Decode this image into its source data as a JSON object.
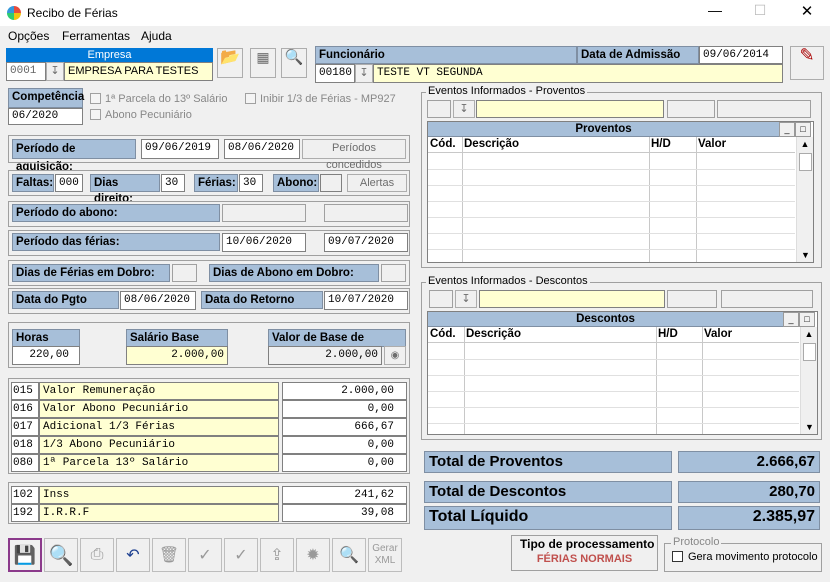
{
  "window": {
    "title": "Recibo de Férias"
  },
  "menu": [
    "Opções",
    "Ferramentas",
    "Ajuda"
  ],
  "empresa": {
    "label": "Empresa",
    "code": "0001",
    "name": "EMPRESA PARA TESTES"
  },
  "funcionario": {
    "label": "Funcionário",
    "code": "00180",
    "name": "TESTE VT SEGUNDA",
    "admissao_label": "Data de Admissão",
    "admissao": "09/06/2014"
  },
  "competencia": {
    "label": "Competência",
    "value": "06/2020"
  },
  "options": {
    "parcela13": "1ª Parcela do 13º Salário",
    "abono": "Abono Pecuniário",
    "inibir": "Inibir 1/3 de Férias - MP927"
  },
  "aquisicao": {
    "label": "Período de aquisição:",
    "start": "09/06/2019",
    "end": "08/06/2020",
    "btn": "Períodos concedidos"
  },
  "faltas": {
    "faltas_label": "Faltas:",
    "faltas": "000",
    "dias_label": "Dias direito:",
    "dias": "30",
    "ferias_label": "Férias:",
    "ferias": "30",
    "abono_label": "Abono:",
    "abono": "",
    "alertas": "Alertas"
  },
  "periodo_abono": {
    "label": "Período do abono:"
  },
  "periodo_ferias": {
    "label": "Período das férias:",
    "start": "10/06/2020",
    "end": "09/07/2020"
  },
  "dobro": {
    "ferias_label": "Dias de Férias em Dobro:",
    "abono_label": "Dias de Abono em Dobro:"
  },
  "datas": {
    "pgto_label": "Data do Pgto",
    "pgto": "08/06/2020",
    "retorno_label": "Data do Retorno",
    "retorno": "10/07/2020"
  },
  "base": {
    "horas_label": "Horas Base",
    "horas": "220,00",
    "salario_label": "Salário Base",
    "salario": "2.000,00",
    "calc_label": "Valor de Base de Cálculo",
    "calc": "2.000,00"
  },
  "proventos_list": [
    {
      "code": "015",
      "desc": "Valor Remuneração",
      "value": "2.000,00"
    },
    {
      "code": "016",
      "desc": "Valor Abono Pecuniário",
      "value": "0,00"
    },
    {
      "code": "017",
      "desc": "Adicional 1/3 Férias",
      "value": "666,67"
    },
    {
      "code": "018",
      "desc": "1/3 Abono Pecuniário",
      "value": "0,00"
    },
    {
      "code": "080",
      "desc": "1ª Parcela 13º Salário",
      "value": "0,00"
    }
  ],
  "descontos_list": [
    {
      "code": "102",
      "desc": "Inss",
      "value": "241,62"
    },
    {
      "code": "192",
      "desc": "I.R.R.F",
      "value": "39,08"
    }
  ],
  "eventos_proventos": {
    "title": "Eventos Informados - Proventos",
    "grid_title": "Proventos",
    "cols": [
      "Cód.",
      "Descrição",
      "H/D",
      "Valor"
    ]
  },
  "eventos_descontos": {
    "title": "Eventos Informados - Descontos",
    "grid_title": "Descontos",
    "cols": [
      "Cód.",
      "Descrição",
      "H/D",
      "Valor"
    ]
  },
  "totais": {
    "proventos_label": "Total de Proventos",
    "proventos": "2.666,67",
    "descontos_label": "Total de Descontos",
    "descontos": "280,70",
    "liquido_label": "Total Líquido",
    "liquido": "2.385,97"
  },
  "tipo": {
    "label": "Tipo de processamento",
    "value": "FÉRIAS NORMAIS"
  },
  "protocolo": {
    "label": "Protocolo",
    "check": "Gera movimento protocolo"
  },
  "toolbar": {
    "gerar_xml": "Gerar XML"
  },
  "colors": {
    "label_bg": "#a7bfd9",
    "yellow_field": "#ffffd2",
    "tipo_value": "#c0504d"
  }
}
